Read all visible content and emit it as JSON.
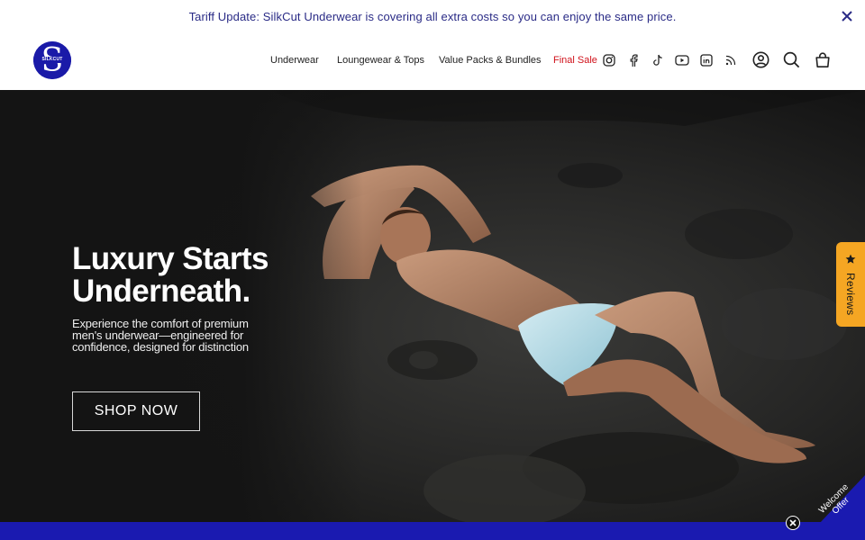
{
  "announcement": {
    "text": "Tariff Update: SilkCut Underwear is covering all extra costs so you can enjoy the same price.",
    "close_icon": "close-icon"
  },
  "brand": {
    "logo_letter": "S",
    "logo_text": "SILKCUT",
    "color": "#1a1aa8"
  },
  "nav": {
    "items": [
      {
        "label": "Underwear"
      },
      {
        "label": "Loungewear & Tops"
      },
      {
        "label": "Value Packs & Bundles"
      },
      {
        "label": "Final Sale"
      }
    ],
    "social_icons": [
      "instagram-icon",
      "facebook-icon",
      "tiktok-icon",
      "youtube-icon",
      "linkedin-icon",
      "rss-icon"
    ],
    "action_icons": [
      "account-icon",
      "search-icon",
      "cart-icon"
    ],
    "sale_color": "#d0121b"
  },
  "hero": {
    "heading_line1": "Luxury Starts",
    "heading_line2": "Underneath.",
    "subtext": "Experience the comfort of premium men's underwear—engineered for confidence, designed for distinction",
    "cta_label": "SHOP NOW"
  },
  "reviews_tab": {
    "label": "Reviews",
    "icon": "star-icon",
    "color": "#f5a623"
  },
  "welcome_offer": {
    "label": "Welcome Offer",
    "close_icon": "close-icon",
    "color": "#1a1ab0"
  },
  "announcement_color": "#2a2b86"
}
